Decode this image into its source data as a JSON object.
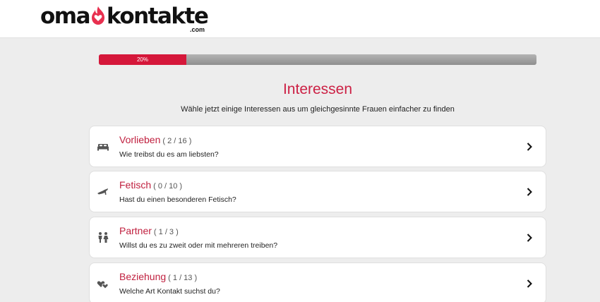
{
  "logo": {
    "left_text": "oma",
    "right_text": "kontakte",
    "suffix": ".com"
  },
  "progress": {
    "percent": 20,
    "label": "20%"
  },
  "page": {
    "title": "Interessen",
    "subtitle": "Wähle jetzt einige Interessen aus um gleichgesinnte Frauen einfacher zu finden"
  },
  "categories": [
    {
      "name": "Vorlieben",
      "count": "( 2 / 16 )",
      "question": "Wie treibst du es am liebsten?",
      "icon": "bed-icon"
    },
    {
      "name": "Fetisch",
      "count": "( 0 / 10 )",
      "question": "Hast du einen besonderen Fetisch?",
      "icon": "high-heel-icon"
    },
    {
      "name": "Partner",
      "count": "( 1 / 3 )",
      "question": "Willst du es zu zweit oder mit mehreren treiben?",
      "icon": "couple-icon"
    },
    {
      "name": "Beziehung",
      "count": "( 1 / 13 )",
      "question": "Welche Art Kontakt suchst du?",
      "icon": "hearts-icon"
    }
  ],
  "colors": {
    "accent": "#d5173a",
    "title": "#cc2145"
  }
}
